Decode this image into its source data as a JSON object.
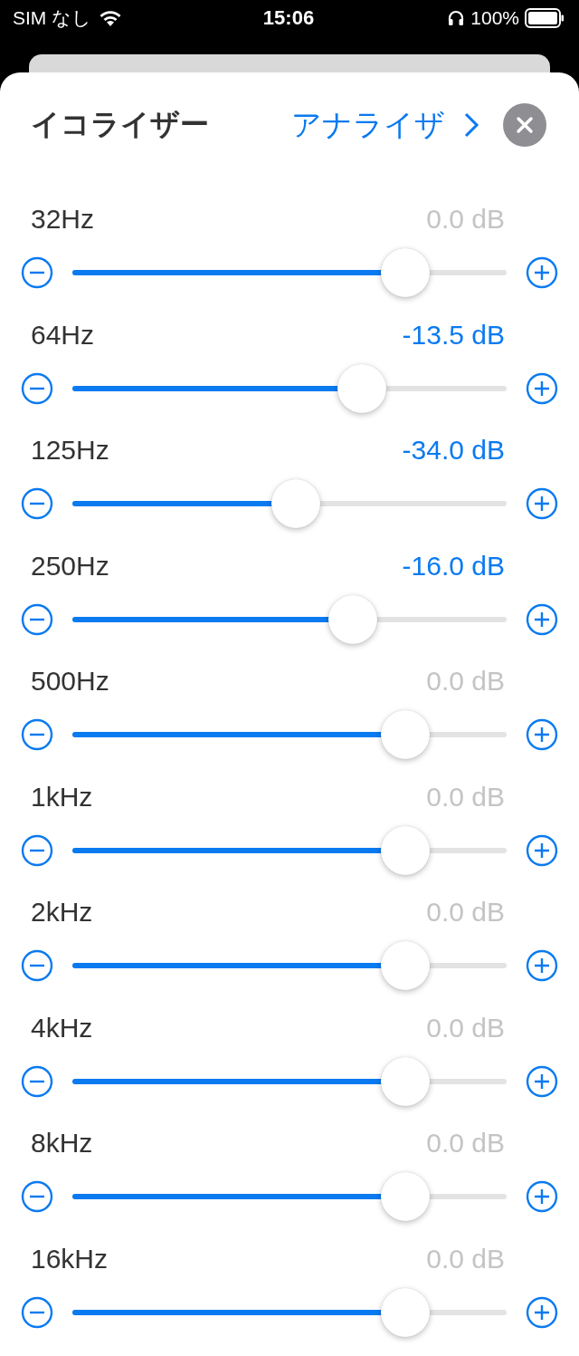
{
  "status_bar": {
    "carrier": "SIM なし",
    "time": "15:06",
    "battery": "100%"
  },
  "sheet": {
    "title": "イコライザー",
    "link": "アナライザ"
  },
  "bands": [
    {
      "label": "32Hz",
      "reading": "0.0 dB",
      "modified": false,
      "level": 0.767
    },
    {
      "label": "64Hz",
      "reading": "-13.5 dB",
      "modified": true,
      "level": 0.667
    },
    {
      "label": "125Hz",
      "reading": "-34.0 dB",
      "modified": true,
      "level": 0.515
    },
    {
      "label": "250Hz",
      "reading": "-16.0 dB",
      "modified": true,
      "level": 0.646
    },
    {
      "label": "500Hz",
      "reading": "0.0 dB",
      "modified": false,
      "level": 0.767
    },
    {
      "label": "1kHz",
      "reading": "0.0 dB",
      "modified": false,
      "level": 0.767
    },
    {
      "label": "2kHz",
      "reading": "0.0 dB",
      "modified": false,
      "level": 0.767
    },
    {
      "label": "4kHz",
      "reading": "0.0 dB",
      "modified": false,
      "level": 0.767
    },
    {
      "label": "8kHz",
      "reading": "0.0 dB",
      "modified": false,
      "level": 0.767
    },
    {
      "label": "16kHz",
      "reading": "0.0 dB",
      "modified": false,
      "level": 0.767
    }
  ]
}
